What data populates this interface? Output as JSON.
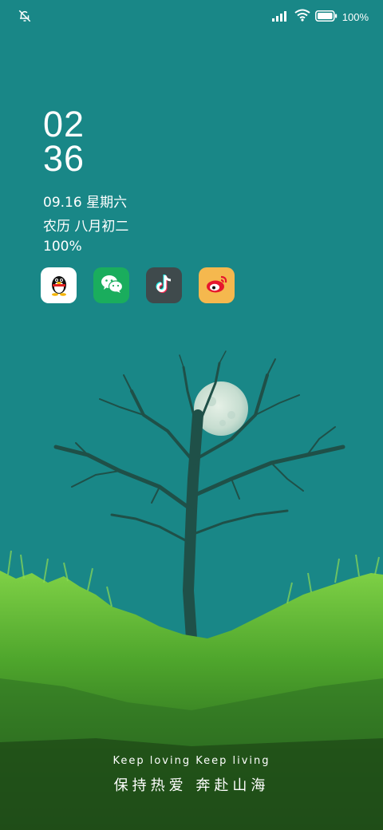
{
  "status_bar": {
    "left_icon": "bell-muted-icon",
    "signal_icon": "cellular-signal-icon",
    "wifi_icon": "wifi-icon",
    "battery_icon": "battery-icon",
    "battery_text": "100%"
  },
  "clock": {
    "hours": "02",
    "minutes": "36"
  },
  "date_line": "09.16 星期六",
  "lunar_line": "农历 八月初二",
  "battery_line": "100%",
  "shortcuts": [
    {
      "icon": "qq-penguin-icon",
      "color": "#ffffff"
    },
    {
      "icon": "wechat-icon",
      "color": "#1aad5d"
    },
    {
      "icon": "tiktok-icon",
      "color": "#3f4a4c"
    },
    {
      "icon": "weibo-icon",
      "color": "#f5b84e"
    }
  ],
  "slogan": {
    "english": "Keep loving  Keep living",
    "chinese": "保持热爱 奔赴山海"
  },
  "colors": {
    "sky": "#198787",
    "moon": "#cfe3d8",
    "grass_light": "#6fc43c",
    "grass_dark": "#24561b",
    "tree": "#1f5048"
  }
}
